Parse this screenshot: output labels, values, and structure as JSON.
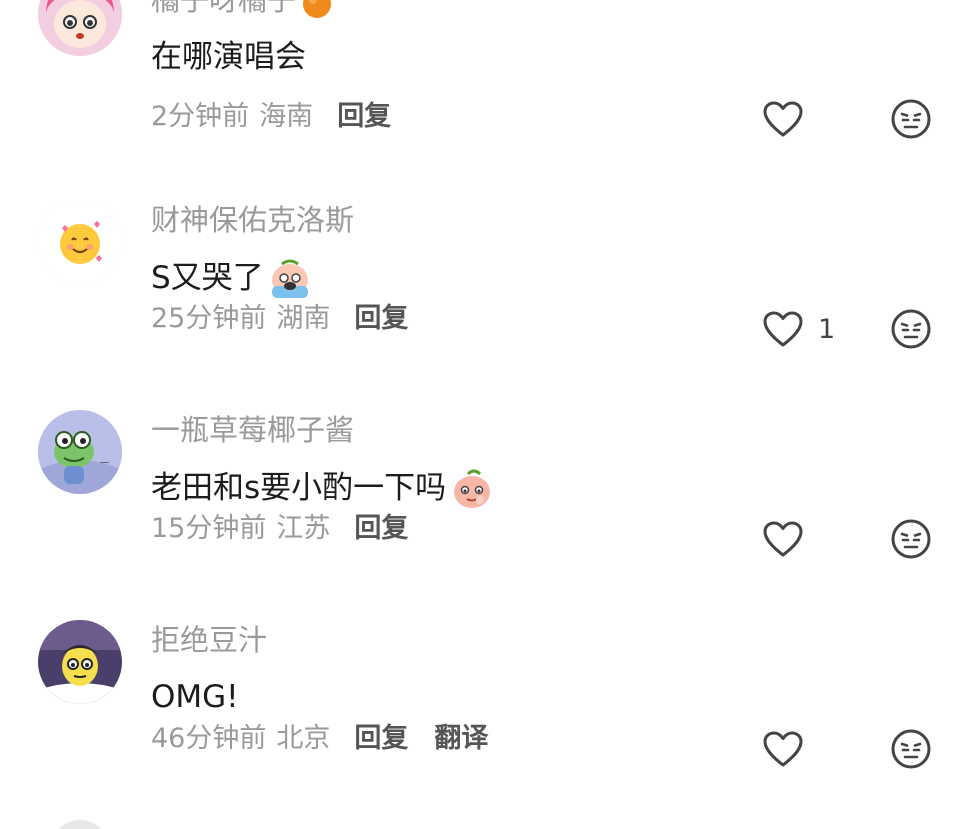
{
  "comments": [
    {
      "username": "橘子呀橘子",
      "username_emoji": "orange-icon",
      "text": "在哪演唱会",
      "text_emoji": null,
      "time": "2分钟前",
      "location": "海南",
      "reply": "回复",
      "translate": null,
      "likes": null,
      "avatar": "anime-girl-avatar"
    },
    {
      "username": "财神保佑克洛斯",
      "username_emoji": null,
      "text": "S又哭了",
      "text_emoji": "crying-emoji",
      "time": "25分钟前",
      "location": "湖南",
      "reply": "回复",
      "translate": null,
      "likes": "1",
      "avatar": "smiling-face-with-hearts-avatar"
    },
    {
      "username": "一瓶草莓椰子酱",
      "username_emoji": null,
      "text": "老田和s要小酌一下吗",
      "text_emoji": "peach-face-emoji",
      "time": "15分钟前",
      "location": "江苏",
      "reply": "回复",
      "translate": null,
      "likes": null,
      "avatar": "frog-cartoon-avatar"
    },
    {
      "username": "拒绝豆汁",
      "username_emoji": null,
      "text": "OMG!",
      "text_emoji": null,
      "time": "46分钟前",
      "location": "北京",
      "reply": "回复",
      "translate": "翻译",
      "likes": null,
      "avatar": "cartoon-man-avatar"
    }
  ],
  "colors": {
    "username": "#9a9a9a",
    "text": "#1c1c1c",
    "meta": "#9a9a9a",
    "action": "#555555"
  }
}
